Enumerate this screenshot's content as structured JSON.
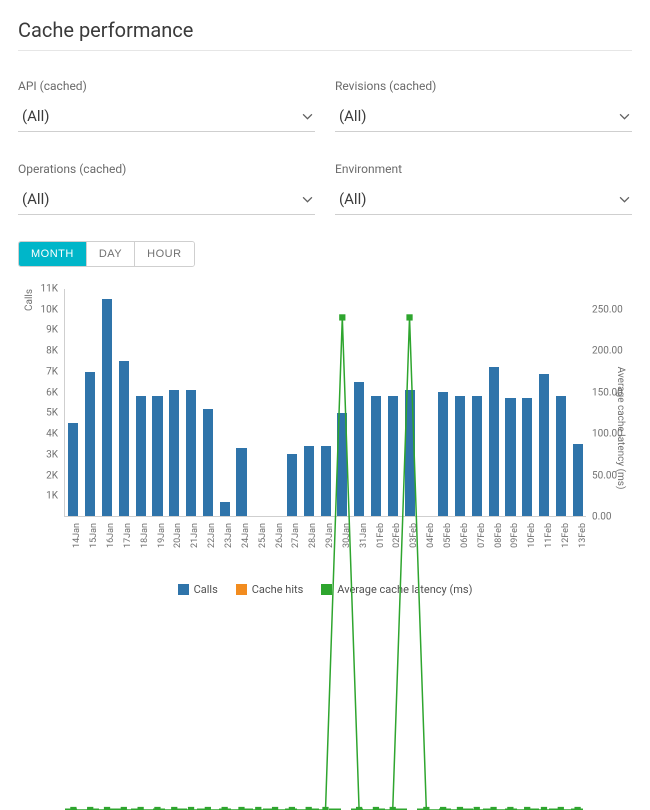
{
  "title": "Cache performance",
  "filters": {
    "api": {
      "label": "API (cached)",
      "value": "(All)"
    },
    "revisions": {
      "label": "Revisions (cached)",
      "value": "(All)"
    },
    "operations": {
      "label": "Operations (cached)",
      "value": "(All)"
    },
    "environment": {
      "label": "Environment",
      "value": "(All)"
    }
  },
  "range_toggle": {
    "month": "MONTH",
    "day": "DAY",
    "hour": "HOUR",
    "active": "month"
  },
  "legend": {
    "calls": {
      "label": "Calls",
      "color": "#2f74aa"
    },
    "hits": {
      "label": "Cache hits",
      "color": "#f28c1f"
    },
    "latency": {
      "label": "Average cache latency (ms)",
      "color": "#2ea52e"
    }
  },
  "axes": {
    "left": {
      "title": "Calls",
      "ticks": [
        "1K",
        "2K",
        "3K",
        "4K",
        "5K",
        "6K",
        "7K",
        "8K",
        "9K",
        "10K",
        "11K"
      ],
      "max": 11000
    },
    "right": {
      "title": "Average cache latency (ms)",
      "ticks": [
        "0.00",
        "50.00",
        "100.00",
        "150.00",
        "200.00",
        "250.00"
      ],
      "max": 275
    }
  },
  "chart_data": {
    "type": "bar",
    "categories": [
      "14Jan",
      "15Jan",
      "16Jan",
      "17Jan",
      "18Jan",
      "19Jan",
      "20Jan",
      "21Jan",
      "22Jan",
      "23Jan",
      "24Jan",
      "25Jan",
      "26Jan",
      "27Jan",
      "28Jan",
      "29Jan",
      "30Jan",
      "31Jan",
      "01Feb",
      "02Feb",
      "03Feb",
      "04Feb",
      "05Feb",
      "06Feb",
      "07Feb",
      "08Feb",
      "09Feb",
      "10Feb",
      "11Feb",
      "12Feb",
      "13Feb"
    ],
    "series": [
      {
        "name": "Calls",
        "type": "bar",
        "axis": "left",
        "color": "#2f74aa",
        "values": [
          4500,
          7000,
          10500,
          7500,
          5800,
          5800,
          6100,
          6100,
          5200,
          700,
          3300,
          0,
          0,
          3000,
          3400,
          3400,
          5000,
          6500,
          5800,
          5800,
          6100,
          0,
          6000,
          5800,
          5800,
          7200,
          5700,
          5700,
          6900,
          5800,
          3500
        ]
      },
      {
        "name": "Cache hits",
        "type": "bar",
        "axis": "left",
        "color": "#f28c1f",
        "values": [
          0,
          0,
          0,
          0,
          0,
          0,
          0,
          0,
          0,
          0,
          0,
          0,
          0,
          0,
          0,
          0,
          0,
          0,
          0,
          0,
          0,
          0,
          0,
          0,
          0,
          0,
          0,
          0,
          0,
          0,
          0
        ]
      },
      {
        "name": "Average cache latency (ms)",
        "type": "line",
        "axis": "right",
        "color": "#2ea52e",
        "values": [
          0,
          0,
          0,
          0,
          0,
          0,
          0,
          0,
          0,
          0,
          0,
          0,
          0,
          0,
          0,
          0,
          260,
          0,
          0,
          0,
          260,
          0,
          0,
          0,
          0,
          0,
          0,
          0,
          0,
          0,
          0
        ]
      }
    ],
    "title": "",
    "xlabel": "",
    "ylabel_left": "Calls",
    "ylabel_right": "Average cache latency (ms)",
    "ylim_left": [
      0,
      11000
    ],
    "ylim_right": [
      0,
      275
    ]
  }
}
